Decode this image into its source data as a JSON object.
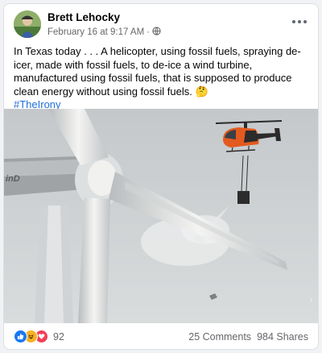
{
  "post": {
    "author": "Brett Lehocky",
    "timestamp": "February 16 at 9:17 AM",
    "meta_separator": "·",
    "audience_icon": "globe-icon",
    "text": "In Texas today . . . A helicopter, using fossil fuels, spraying de-icer, made with fossil fuels, to de-ice a wind turbine, manufactured using fossil fuels, that is supposed to produce clean energy without using fossil fuels. 🤔",
    "hashtag": "#TheIrony"
  },
  "photo": {
    "turbine_label": "inD"
  },
  "engagement": {
    "reaction_icons": [
      "like-icon",
      "haha-icon",
      "love-icon"
    ],
    "reaction_count": "92",
    "comments": "25 Comments",
    "shares": "984 Shares"
  },
  "colors": {
    "link": "#216fdb",
    "like": "#1877f2",
    "love": "#f33e58",
    "haha": "#f7b125",
    "secondary_text": "#65676b"
  }
}
